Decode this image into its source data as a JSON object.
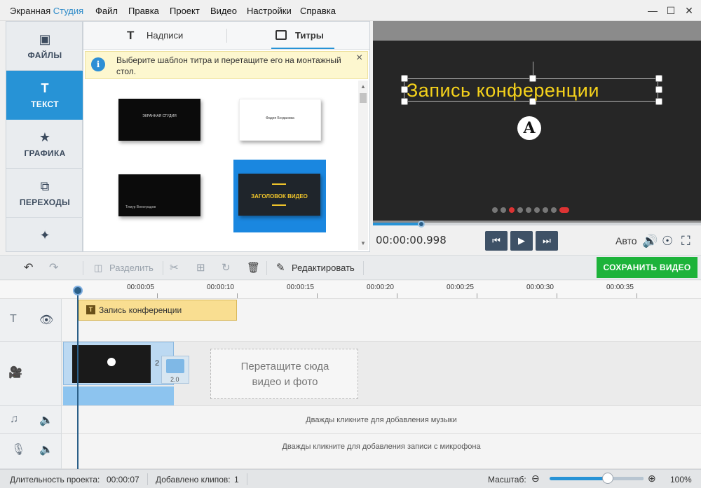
{
  "app": {
    "title_part1": "Экранная",
    "title_part2": "Студия"
  },
  "menu": [
    "Файл",
    "Правка",
    "Проект",
    "Видео",
    "Настройки",
    "Справка"
  ],
  "window_controls": [
    "minimize-icon",
    "maximize-icon",
    "close-icon"
  ],
  "sidebar": {
    "items": [
      {
        "label": "ФАЙЛЫ",
        "icon": "image-icon"
      },
      {
        "label": "ТЕКСТ",
        "icon": "text-icon",
        "active": true
      },
      {
        "label": "ГРАФИКА",
        "icon": "star-icon"
      },
      {
        "label": "ПЕРЕХОДЫ",
        "icon": "transitions-icon"
      },
      {
        "label": "",
        "icon": "magic-wand-icon"
      }
    ]
  },
  "panel": {
    "tabs": [
      {
        "label": "Надписи",
        "icon": "text-t-icon"
      },
      {
        "label": "Титры",
        "icon": "film-icon",
        "active": true
      }
    ],
    "notice": "Выберите шаблон титра и перетащите его на монтажный стол.",
    "templates": [
      {
        "text": "ЭКРАННАЯ СТУДИЯ"
      },
      {
        "text": "Фадея Богданова"
      },
      {
        "text": "Тимур Виноградов"
      },
      {
        "text": "ЗАГОЛОВОК ВИДЕО",
        "selected": true
      }
    ]
  },
  "preview": {
    "caption": "Запись конференции",
    "logo": "A",
    "timecode": "00:00:00.998",
    "progress_fraction": 0.15,
    "quality": "Авто"
  },
  "toolbar": {
    "undo": "undo-icon",
    "redo": "redo-icon",
    "split": "Разделить",
    "edit": "Редактировать",
    "save": "СОХРАНИТЬ ВИДЕО"
  },
  "timeline": {
    "ticks": [
      "00:00:05",
      "00:00:10",
      "00:00:15",
      "00:00:20",
      "00:00:25",
      "00:00:30",
      "00:00:35"
    ],
    "title_clip": "Запись конференции",
    "transition_duration": "2.0",
    "dropzone": "Перетащите сюда видео и фото",
    "music_hint": "Дважды кликните для добавления музыки",
    "mic_hint": "Дважды кликните для добавления записи с микрофона"
  },
  "status": {
    "duration_label": "Длительность проекта:",
    "duration": "00:00:07",
    "clips_label": "Добавлено клипов:",
    "clips": "1",
    "zoom_label": "Масштаб:",
    "zoom_value": "100%",
    "zoom_fraction": 0.62
  }
}
